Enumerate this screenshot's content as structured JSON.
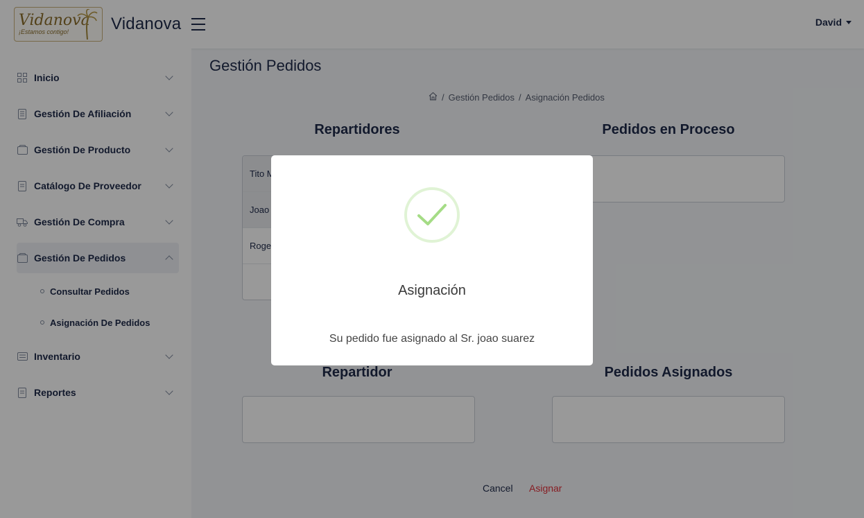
{
  "header": {
    "logo_text": "Vidanova",
    "logo_tagline": "¡Estamos contigo!",
    "brand_name": "Vidanova",
    "user_name": "David"
  },
  "sidebar": {
    "items": [
      {
        "label": "Inicio",
        "icon": "grid-icon"
      },
      {
        "label": "Gestión De Afiliación",
        "icon": "document-list-icon"
      },
      {
        "label": "Gestión De Producto",
        "icon": "bag-icon"
      },
      {
        "label": "Catálogo De Proveedor",
        "icon": "document-icon"
      },
      {
        "label": "Gestión De Compra",
        "icon": "truck-icon"
      },
      {
        "label": "Gestión De Pedidos",
        "icon": "bag-icon"
      },
      {
        "label": "Inventario",
        "icon": "list-icon"
      },
      {
        "label": "Reportes",
        "icon": "document-icon"
      }
    ],
    "subitems": [
      {
        "label": "Consultar Pedidos"
      },
      {
        "label": "Asignación De Pedidos"
      }
    ]
  },
  "main": {
    "page_title": "Gestión Pedidos",
    "breadcrumb": {
      "sep": "/",
      "item1": "Gestión Pedidos",
      "item2": "Asignación Pedidos"
    },
    "repartidores_title": "Repartidores",
    "pedidos_proceso_title": "Pedidos en Proceso",
    "repartidor_title": "Repartidor",
    "pedidos_asignados_title": "Pedidos Asignados",
    "repartidores": [
      "Tito M",
      "Joao s",
      "Roger"
    ],
    "cancel_label": "Cancel",
    "asignar_label": "Asignar"
  },
  "modal": {
    "title": "Asignación",
    "text": "Su pedido fue asignado al Sr. joao suarez"
  },
  "colors": {
    "accent_red": "#e0303a",
    "success_green": "#a5dc86",
    "text_dark": "#1e2a4a"
  }
}
